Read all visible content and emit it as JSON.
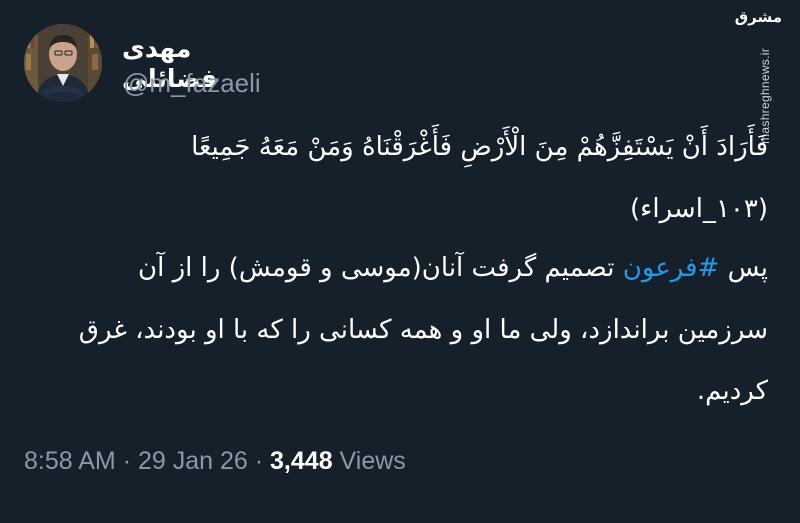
{
  "tweet": {
    "author": {
      "display_name": "مهدی فضائلی",
      "handle": "@m_fazaeli"
    },
    "body": {
      "line1": "فَأَرَادَ أَنْ يَسْتَفِزَّهُمْ مِنَ الْأَرْضِ فَأَغْرَقْنَاهُ وَمَنْ مَعَهُ جَمِيعًا",
      "line2": "(۱۰۳_اسراء)",
      "line3_before": "پس ",
      "hashtag": "#فرعون",
      "line3_after": " تصمیم گرفت آنان(موسی و قومش) را از آن",
      "line4": "سرزمین براندازد، ولی ما او و همه کسانی را که با او بودند، غرق",
      "line5": "کردیم."
    },
    "meta": {
      "time": "8:58 AM",
      "separator": "·",
      "date": "29 Jan 26",
      "views_count": "3,448",
      "views_label": "Views"
    }
  },
  "watermark": {
    "logo_text": "مشرق",
    "site": "mashreghnews.ir"
  },
  "colors": {
    "background": "#15202b",
    "text": "#ffffff",
    "secondary": "#8b98a5",
    "hashtag": "#1d9bf0"
  }
}
